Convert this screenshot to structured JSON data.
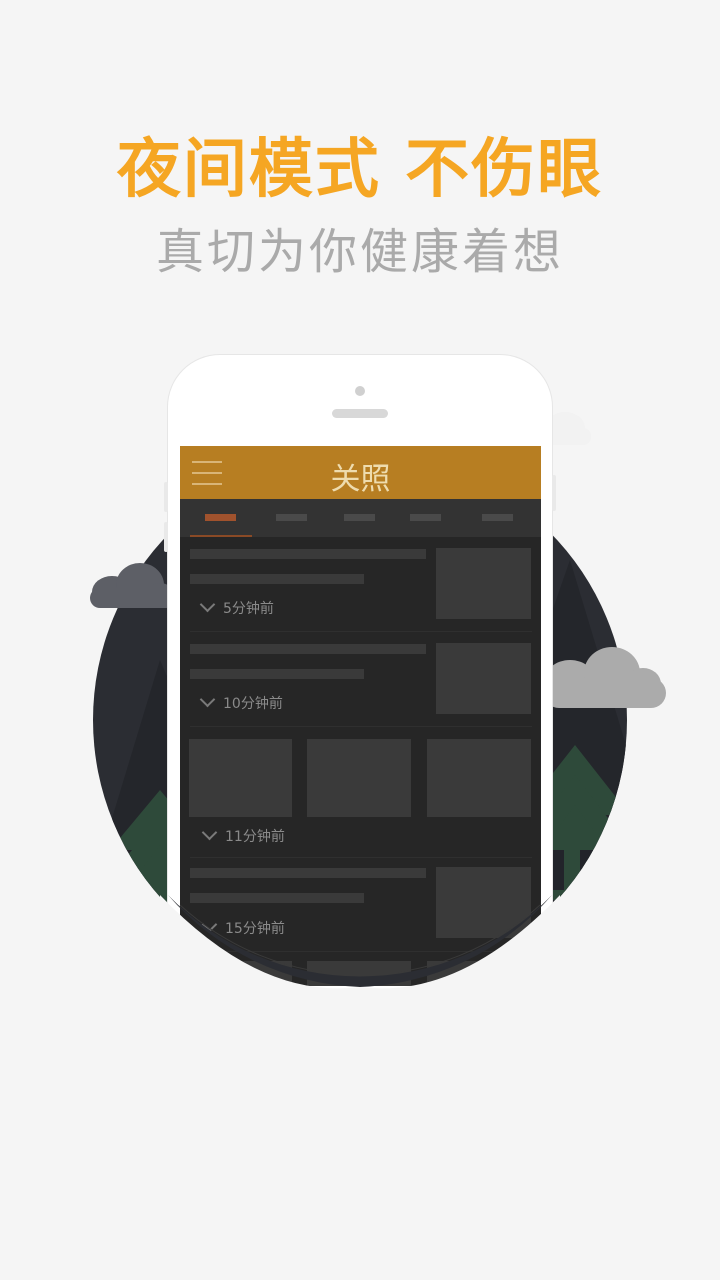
{
  "headline": "夜间模式 不伤眼",
  "subheadline": "真切为你健康着想",
  "colors": {
    "accent": "#f5a623",
    "subtitle": "#aaaaaa",
    "appbar": "#b77e22",
    "night_bg": "#262626",
    "tab_active": "#a0522d"
  },
  "app": {
    "title": "关照",
    "menu_icon": "hamburger-menu-icon",
    "tabs_count": 5,
    "feed": [
      {
        "time": "5分钟前"
      },
      {
        "time": "10分钟前"
      },
      {
        "time": "11分钟前"
      },
      {
        "time": "15分钟前"
      }
    ]
  }
}
